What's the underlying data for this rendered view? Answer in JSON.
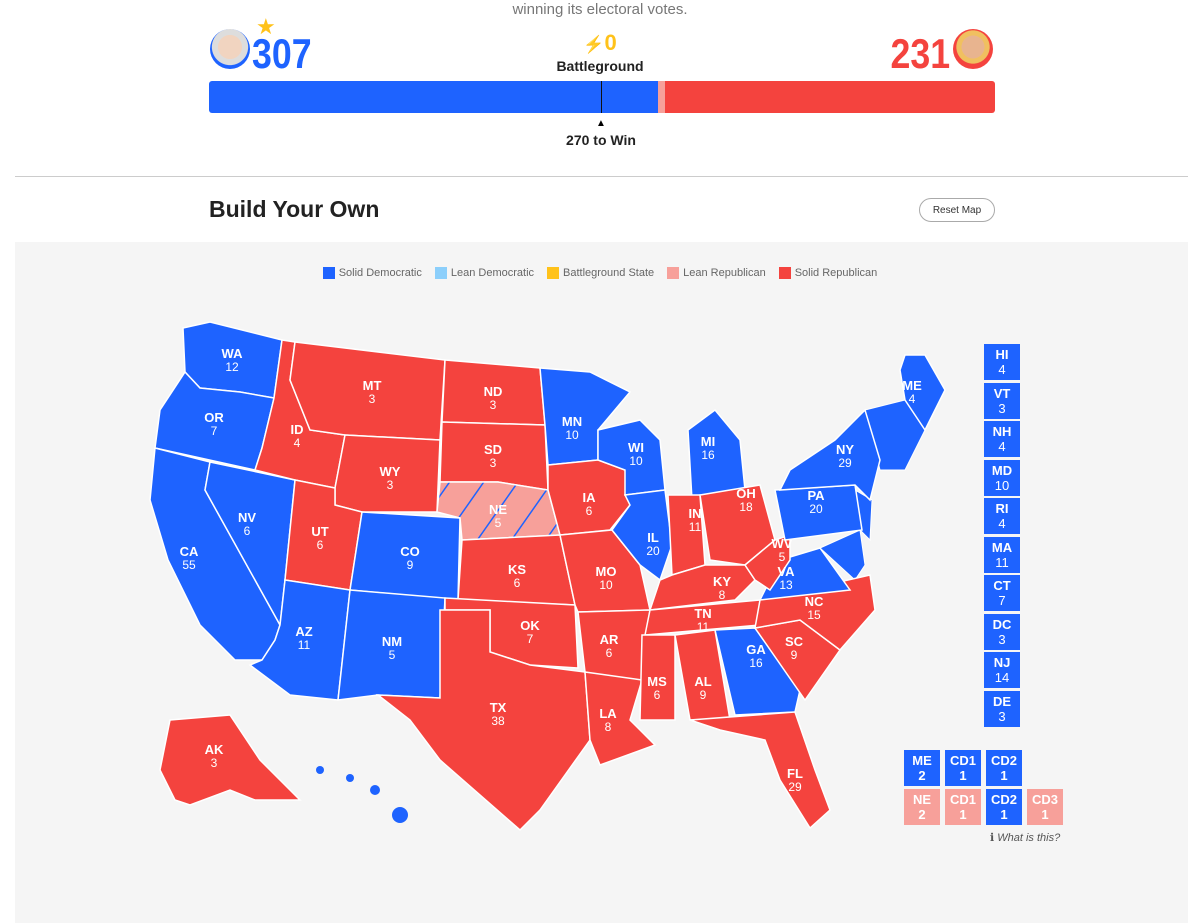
{
  "subtitle": "winning its electoral votes.",
  "scoreboard": {
    "dem_votes": "307",
    "rep_votes": "231",
    "battleground_count": "0",
    "battleground_label": "Battleground",
    "to_win_label": "270 to Win",
    "bar": {
      "dem": 307,
      "lean_rep": 5,
      "rep": 226,
      "total": 538
    }
  },
  "section_title": "Build Your Own",
  "reset_label": "Reset Map",
  "colors": {
    "solid_dem": "#1e63ff",
    "lean_dem": "#8ccffb",
    "battleground": "#ffc21a",
    "lean_rep": "#f7a09a",
    "solid_rep": "#f4433e"
  },
  "legend": [
    {
      "label": "Solid Democratic",
      "key": "solid_dem"
    },
    {
      "label": "Lean Democratic",
      "key": "lean_dem"
    },
    {
      "label": "Battleground State",
      "key": "battleground"
    },
    {
      "label": "Lean Republican",
      "key": "lean_rep"
    },
    {
      "label": "Solid Republican",
      "key": "solid_rep"
    }
  ],
  "states": [
    {
      "abbr": "WA",
      "ev": "12",
      "status": "solid_dem"
    },
    {
      "abbr": "OR",
      "ev": "7",
      "status": "solid_dem"
    },
    {
      "abbr": "CA",
      "ev": "55",
      "status": "solid_dem"
    },
    {
      "abbr": "NV",
      "ev": "6",
      "status": "solid_dem"
    },
    {
      "abbr": "ID",
      "ev": "4",
      "status": "solid_rep"
    },
    {
      "abbr": "MT",
      "ev": "3",
      "status": "solid_rep"
    },
    {
      "abbr": "WY",
      "ev": "3",
      "status": "solid_rep"
    },
    {
      "abbr": "UT",
      "ev": "6",
      "status": "solid_rep"
    },
    {
      "abbr": "AZ",
      "ev": "11",
      "status": "solid_dem"
    },
    {
      "abbr": "CO",
      "ev": "9",
      "status": "solid_dem"
    },
    {
      "abbr": "NM",
      "ev": "5",
      "status": "solid_dem"
    },
    {
      "abbr": "ND",
      "ev": "3",
      "status": "solid_rep"
    },
    {
      "abbr": "SD",
      "ev": "3",
      "status": "solid_rep"
    },
    {
      "abbr": "NE",
      "ev": "5",
      "status": "lean_rep_split"
    },
    {
      "abbr": "KS",
      "ev": "6",
      "status": "solid_rep"
    },
    {
      "abbr": "OK",
      "ev": "7",
      "status": "solid_rep"
    },
    {
      "abbr": "TX",
      "ev": "38",
      "status": "solid_rep"
    },
    {
      "abbr": "MN",
      "ev": "10",
      "status": "solid_dem"
    },
    {
      "abbr": "IA",
      "ev": "6",
      "status": "solid_rep"
    },
    {
      "abbr": "MO",
      "ev": "10",
      "status": "solid_rep"
    },
    {
      "abbr": "AR",
      "ev": "6",
      "status": "solid_rep"
    },
    {
      "abbr": "LA",
      "ev": "8",
      "status": "solid_rep"
    },
    {
      "abbr": "WI",
      "ev": "10",
      "status": "solid_dem"
    },
    {
      "abbr": "IL",
      "ev": "20",
      "status": "solid_dem"
    },
    {
      "abbr": "MI",
      "ev": "16",
      "status": "solid_dem"
    },
    {
      "abbr": "IN",
      "ev": "11",
      "status": "solid_rep"
    },
    {
      "abbr": "OH",
      "ev": "18",
      "status": "solid_rep"
    },
    {
      "abbr": "KY",
      "ev": "8",
      "status": "solid_rep"
    },
    {
      "abbr": "TN",
      "ev": "11",
      "status": "solid_rep"
    },
    {
      "abbr": "MS",
      "ev": "6",
      "status": "solid_rep"
    },
    {
      "abbr": "AL",
      "ev": "9",
      "status": "solid_rep"
    },
    {
      "abbr": "GA",
      "ev": "16",
      "status": "solid_dem"
    },
    {
      "abbr": "FL",
      "ev": "29",
      "status": "solid_rep"
    },
    {
      "abbr": "SC",
      "ev": "9",
      "status": "solid_rep"
    },
    {
      "abbr": "NC",
      "ev": "15",
      "status": "solid_rep"
    },
    {
      "abbr": "VA",
      "ev": "13",
      "status": "solid_dem"
    },
    {
      "abbr": "WV",
      "ev": "5",
      "status": "solid_rep"
    },
    {
      "abbr": "PA",
      "ev": "20",
      "status": "solid_dem"
    },
    {
      "abbr": "NY",
      "ev": "29",
      "status": "solid_dem"
    },
    {
      "abbr": "ME",
      "ev": "4",
      "status": "solid_dem"
    },
    {
      "abbr": "AK",
      "ev": "3",
      "status": "solid_rep"
    }
  ],
  "small_states": [
    {
      "abbr": "HI",
      "ev": "4"
    },
    {
      "abbr": "VT",
      "ev": "3"
    },
    {
      "abbr": "NH",
      "ev": "4"
    },
    {
      "abbr": "MD",
      "ev": "10"
    },
    {
      "abbr": "RI",
      "ev": "4"
    },
    {
      "abbr": "MA",
      "ev": "11"
    },
    {
      "abbr": "CT",
      "ev": "7"
    },
    {
      "abbr": "DC",
      "ev": "3"
    },
    {
      "abbr": "NJ",
      "ev": "14"
    },
    {
      "abbr": "DE",
      "ev": "3"
    }
  ],
  "districts": [
    [
      {
        "abbr": "ME",
        "ev": "2",
        "status": "solid_dem"
      },
      {
        "abbr": "CD1",
        "ev": "1",
        "status": "solid_dem"
      },
      {
        "abbr": "CD2",
        "ev": "1",
        "status": "solid_dem"
      }
    ],
    [
      {
        "abbr": "NE",
        "ev": "2",
        "status": "lean_rep"
      },
      {
        "abbr": "CD1",
        "ev": "1",
        "status": "lean_rep"
      },
      {
        "abbr": "CD2",
        "ev": "1",
        "status": "solid_dem"
      },
      {
        "abbr": "CD3",
        "ev": "1",
        "status": "lean_rep"
      }
    ]
  ],
  "what_is_this": "What is this?"
}
